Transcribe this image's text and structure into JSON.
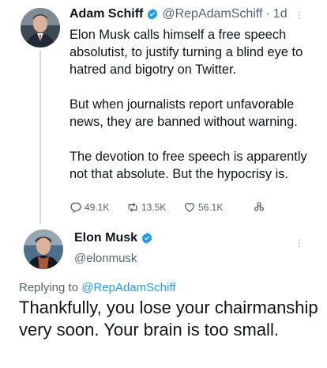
{
  "tweet": {
    "author_name": "Adam Schiff",
    "author_handle": "@RepAdamSchiff",
    "separator": "·",
    "time": "1d",
    "paragraphs": [
      "Elon Musk calls himself a free speech absolutist, to justify turning a blind eye to hatred and bigotry on Twitter.",
      "But when journalists report unfavorable news, they are banned without warning.",
      "The devotion to free speech is apparently not that absolute. But the hypocrisy is."
    ],
    "actions": {
      "replies": "49.1K",
      "retweets": "13.5K",
      "likes": "56.1K"
    },
    "icons": [
      "verified-badge-icon",
      "more-icon",
      "reply-icon",
      "retweet-icon",
      "like-icon",
      "share-icon"
    ],
    "colors": {
      "verified": "#1d9bf0",
      "secondary_text": "#536471",
      "link": "#1d9bf0"
    }
  },
  "reply": {
    "author_name": "Elon Musk",
    "author_handle": "@elonmusk",
    "replying_prefix": "Replying to",
    "replying_to": "@RepAdamSchiff",
    "text": "Thankfully, you lose your chairmanship very soon. Your brain is too small."
  }
}
